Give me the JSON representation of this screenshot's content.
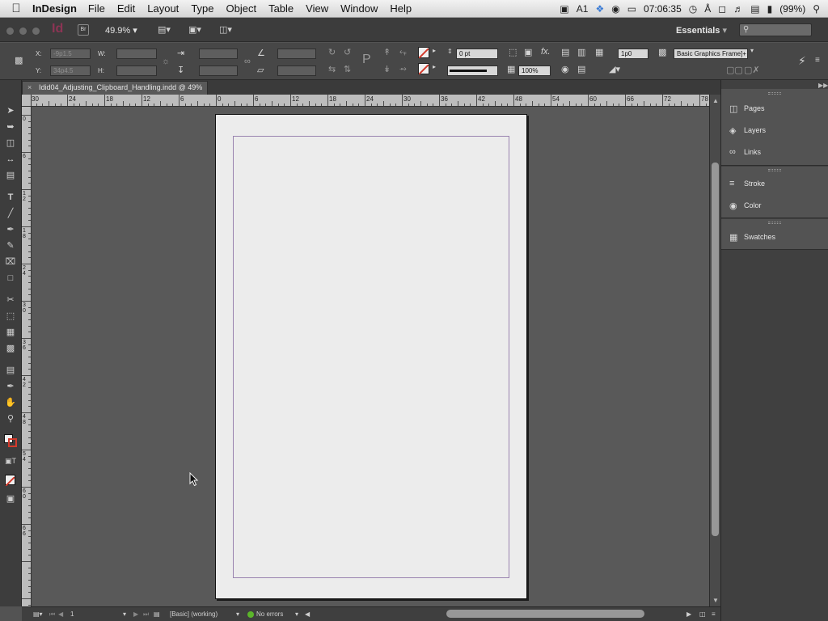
{
  "menubar": {
    "app_name": "InDesign",
    "menus": [
      "File",
      "Edit",
      "Layout",
      "Type",
      "Object",
      "Table",
      "View",
      "Window",
      "Help"
    ],
    "status": {
      "a1_label": "1",
      "clock": "07:06:35",
      "battery": "(99%)"
    }
  },
  "appbar": {
    "app_logo": "Id",
    "bridge_label": "Br",
    "zoom": "49.9%",
    "workspace": "Essentials",
    "workspace_arrow": "▾"
  },
  "control": {
    "x_label": "X:",
    "x_value": "-9p1.5",
    "y_label": "Y:",
    "y_value": "34p4.5",
    "w_label": "W:",
    "h_label": "H:",
    "stroke_weight": "0 pt",
    "opacity": "100%",
    "ref_value": "1p0",
    "object_style": "Basic Graphics Frame]+"
  },
  "document": {
    "tab_title": "Idid04_Adjusting_Clipboard_Handling.indd @ 49%"
  },
  "ruler": {
    "h_labels": [
      "30",
      "24",
      "18",
      "12",
      "6",
      "0",
      "6",
      "12",
      "18",
      "24",
      "30",
      "36",
      "42",
      "48",
      "54",
      "60",
      "66",
      "72",
      "78"
    ],
    "v_labels": [
      "0",
      "6",
      "1 2",
      "1 8",
      "2 4",
      "3 0",
      "3 6",
      "4 2",
      "4 8",
      "5 4",
      "6 0",
      "6 6"
    ]
  },
  "status": {
    "page_number": "1",
    "master": "[Basic] (working)",
    "preflight": "No errors"
  },
  "panels": {
    "items": [
      {
        "label": "Pages",
        "icon": "pages-icon"
      },
      {
        "label": "Layers",
        "icon": "layers-icon"
      },
      {
        "label": "Links",
        "icon": "links-icon"
      },
      {
        "label": "Stroke",
        "icon": "stroke-icon"
      },
      {
        "label": "Color",
        "icon": "color-icon"
      },
      {
        "label": "Swatches",
        "icon": "swatches-icon"
      }
    ]
  },
  "colors": {
    "margin_guide": "#9a84b0",
    "id_logo": "#8c3454",
    "stroke_none": "#d23a2c"
  }
}
